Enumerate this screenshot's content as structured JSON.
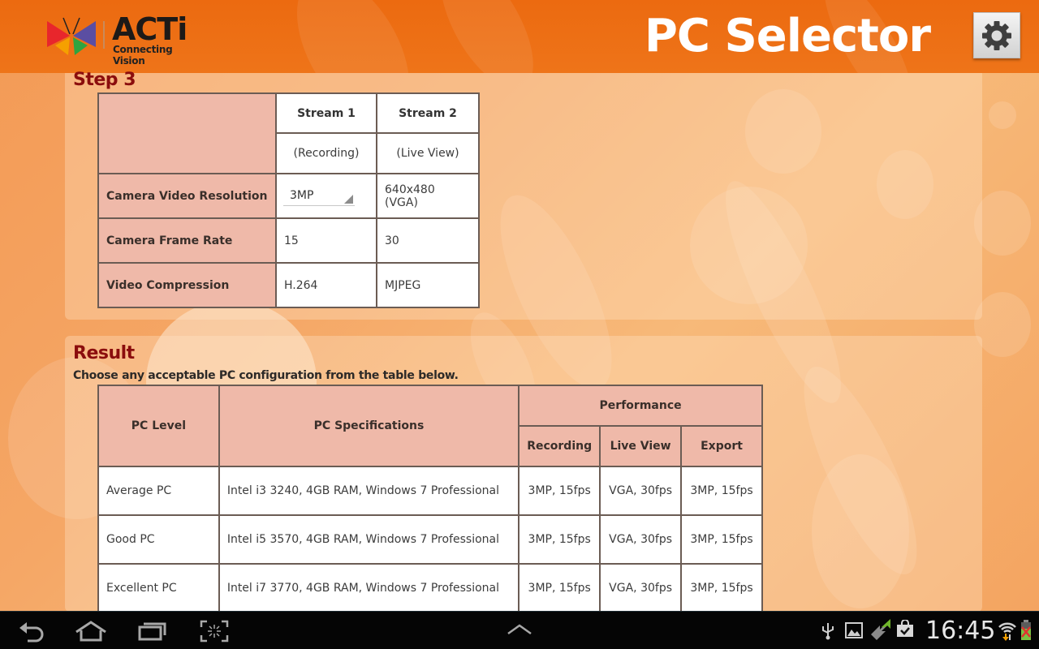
{
  "header": {
    "logo_text": "ACTi",
    "logo_tagline": "Connecting Vision",
    "title": "PC Selector",
    "settings_icon": "gear-icon"
  },
  "step": {
    "title": "Step 3",
    "columns": [
      {
        "name": "Stream 1",
        "sub": "(Recording)"
      },
      {
        "name": "Stream 2",
        "sub": "(Live View)"
      }
    ],
    "rows": [
      {
        "label": "Camera Video Resolution",
        "stream1": "3MP",
        "stream1_type": "dropdown",
        "stream2": "640x480 (VGA)"
      },
      {
        "label": "Camera Frame Rate",
        "stream1": "15",
        "stream2": "30"
      },
      {
        "label": "Video Compression",
        "stream1": "H.264",
        "stream2": "MJPEG"
      }
    ]
  },
  "result": {
    "title": "Result",
    "subtitle": "Choose any acceptable PC configuration from the table below.",
    "headers": {
      "level": "PC Level",
      "specs": "PC Specifications",
      "performance": "Performance",
      "recording": "Recording",
      "live_view": "Live View",
      "export": "Export"
    },
    "rows": [
      {
        "level": "Average PC",
        "specs": "Intel i3 3240, 4GB RAM, Windows 7 Professional",
        "recording": "3MP, 15fps",
        "live_view": "VGA, 30fps",
        "export": "3MP, 15fps"
      },
      {
        "level": "Good PC",
        "specs": "Intel i5 3570, 4GB RAM, Windows 7 Professional",
        "recording": "3MP, 15fps",
        "live_view": "VGA, 30fps",
        "export": "3MP, 15fps"
      },
      {
        "level": "Excellent PC",
        "specs": "Intel i7 3770, 4GB RAM, Windows 7 Professional",
        "recording": "3MP, 15fps",
        "live_view": "VGA, 30fps",
        "export": "3MP, 15fps"
      }
    ]
  },
  "navbar": {
    "buttons": [
      "back-icon",
      "home-icon",
      "recent-apps-icon",
      "screenshot-icon",
      "expand-up-icon"
    ],
    "status_icons": [
      "usb-icon",
      "gallery-icon",
      "sync-icon",
      "store-icon",
      "wifi-icon",
      "battery-icon"
    ],
    "clock": "16:45"
  },
  "colors": {
    "header_orange": "#ec6a10",
    "section_title": "#8b0d0d",
    "table_header_fill": "#efb9a9",
    "table_border": "#6b5c54"
  }
}
